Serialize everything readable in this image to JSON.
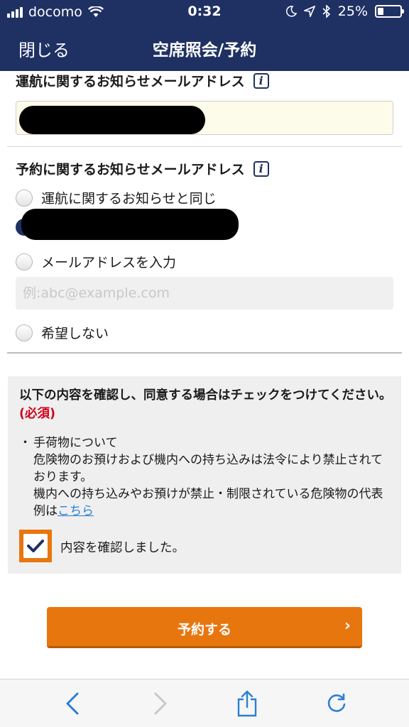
{
  "status_bar": {
    "carrier": "docomo",
    "time": "0:32",
    "battery": "25%",
    "battery_level": 0.25,
    "icons": [
      "signal-icon",
      "wifi-icon",
      "moon-icon",
      "location-icon",
      "bluetooth-icon",
      "battery-icon"
    ]
  },
  "nav": {
    "close_label": "閉じる",
    "title": "空席照会/予約"
  },
  "operation_email": {
    "label": "運航に関するお知らせメールアドレス",
    "info_icon": "i",
    "value_redacted": true
  },
  "booking_email": {
    "label": "予約に関するお知らせメールアドレス",
    "info_icon": "i",
    "options": [
      {
        "label": "運航に関するお知らせと同じ",
        "checked": false
      },
      {
        "label": "",
        "checked": true,
        "redacted": true
      },
      {
        "label": "メールアドレスを入力",
        "checked": false
      },
      {
        "label": "希望しない",
        "checked": false
      }
    ],
    "input_placeholder": "例:abc@example.com"
  },
  "agreement": {
    "heading": "以下の内容を確認し、同意する場合はチェックをつけてください。",
    "required": "(必須)",
    "bullet_mark": "・",
    "bullet_title": "手荷物について",
    "line1": "危険物のお預けおよび機内への持ち込みは法令により禁止されております。",
    "line2": "機内への持ち込みやお預けが禁止・制限されている危険物の代表例は",
    "link": "こちら",
    "checkbox_label": "内容を確認しました。",
    "checked": true
  },
  "submit": {
    "label": "予約する",
    "chevron": "›"
  },
  "colors": {
    "header": "#1f3063",
    "accent": "#e8760f",
    "link": "#2a7fd4",
    "required": "#d0021b"
  },
  "toolbar": [
    "back-icon",
    "forward-icon",
    "share-icon",
    "reload-icon"
  ]
}
